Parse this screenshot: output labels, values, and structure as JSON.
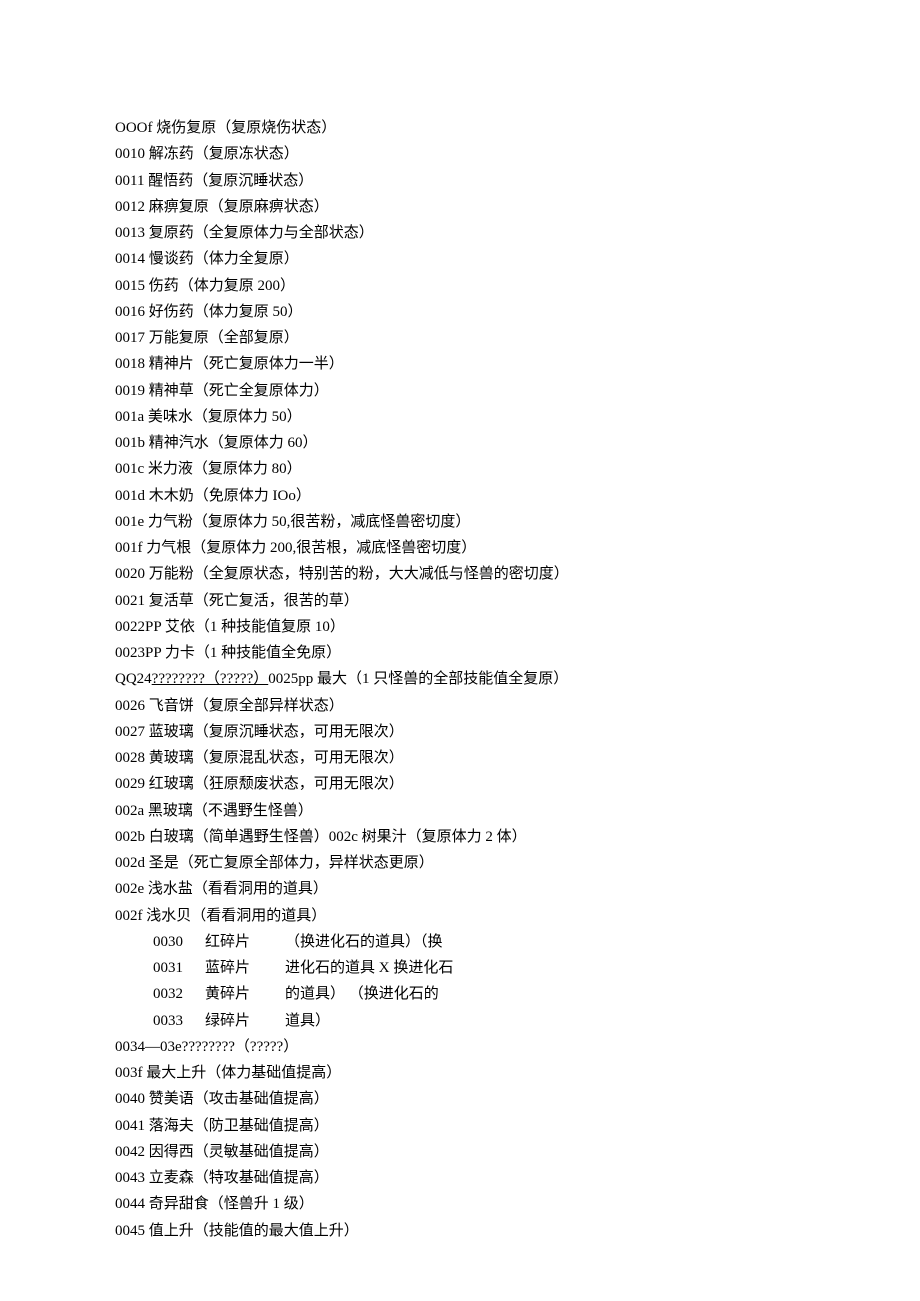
{
  "lines": {
    "l01": "OOOf 烧伤复原（复原烧伤状态）",
    "l02": "0010 解冻药（复原冻状态）",
    "l03": "0011 醒悟药（复原沉睡状态）",
    "l04": "0012 麻痹复原（复原麻痹状态）",
    "l05": "0013 复原药（全复原体力与全部状态）",
    "l06": "0014 慢谈药（体力全复原）",
    "l07": "0015 伤药（体力复原 200）",
    "l08": "0016 好伤药（体力复原 50）",
    "l09": "0017 万能复原（全部复原）",
    "l10": "0018 精神片（死亡复原体力一半）",
    "l11": "0019 精神草（死亡全复原体力）",
    "l12": "001a 美味水（复原体力 50）",
    "l13": "001b 精神汽水（复原体力 60）",
    "l14": "001c 米力液（复原体力 80）",
    "l15": "001d 木木奶（免原体力 IOo）",
    "l16": "001e 力气粉（复原体力 50,很苦粉，减底怪兽密切度）",
    "l17": "001f 力气根（复原体力 200,很苦根，减底怪兽密切度）",
    "l18": "0020 万能粉（全复原状态，特别苦的粉，大大减低与怪兽的密切度）",
    "l19": "0021 复活草（死亡复活，很苦的草）",
    "l20": "0022PP 艾依（1 种技能值复原 10）",
    "l21": "0023PP 力卡（1 种技能值全免原）",
    "l22a": "QQ24",
    "l22b": "????????（?????）",
    "l22c": "0025pp 最大（1 只怪兽的全部技能值全复原）",
    "l23": "0026 飞音饼（复原全部异样状态）",
    "l24": "0027 蓝玻璃（复原沉睡状态，可用无限次）",
    "l25": "0028 黄玻璃（复原混乱状态，可用无限次）",
    "l26": "0029 红玻璃（狂原颓废状态，可用无限次）",
    "l27": "002a 黑玻璃（不遇野生怪兽）",
    "l28": "002b 白玻璃（简单遇野生怪兽）002c 树果汁（复原体力 2 体）",
    "l29": "002d 圣是（死亡复原全部体力，异样状态更原）",
    "l30": "002e 浅水盐（看看洞用的道具）",
    "l31": "002f 浅水贝（看看洞用的道具）",
    "l32a": "0030",
    "l32b": "红碎片",
    "l32c": " （换进化石的道具）（换",
    "l33a": "0031",
    "l33b": "蓝碎片",
    "l33c": "进化石的道具 X 换进化石",
    "l34a": "0032",
    "l34b": "黄碎片",
    "l34c": "的道具） （换进化石的",
    "l35a": "0033",
    "l35b": "绿碎片",
    "l35c": "道具）",
    "l36": "0034—03e????????（?????）",
    "l37": "003f 最大上升（体力基础值提高）",
    "l38": "0040 赞美语（攻击基础值提高）",
    "l39": "0041 落海夫（防卫基础值提高）",
    "l40": "0042 因得西（灵敏基础值提高）",
    "l41": "0043 立麦森（特攻基础值提高）",
    "l42": "0044 奇异甜食（怪兽升 1 级）",
    "l43": "0045 值上升（技能值的最大值上升）"
  }
}
